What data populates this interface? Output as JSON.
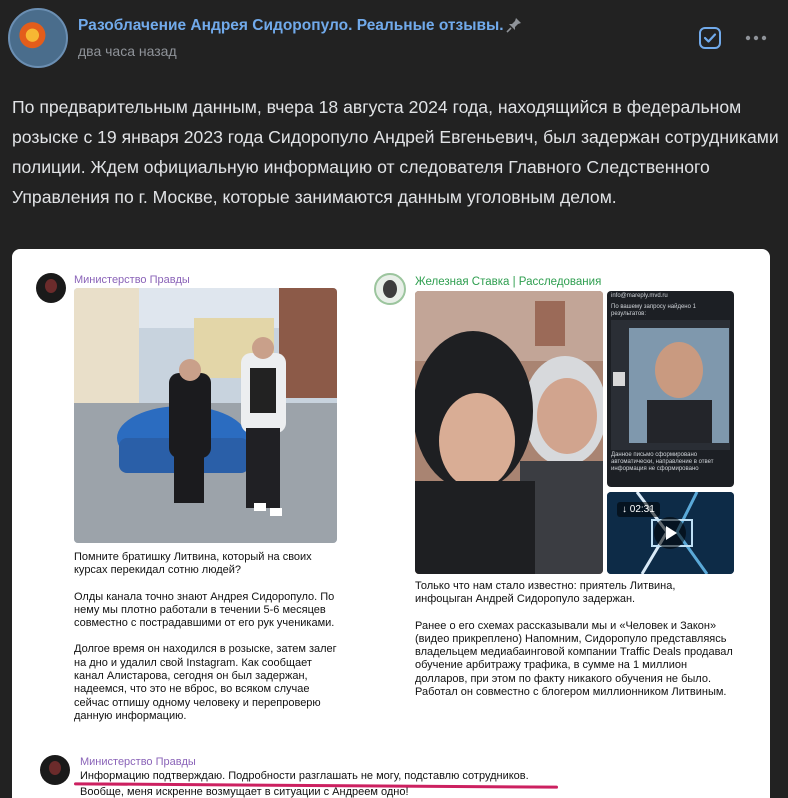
{
  "header": {
    "channel_title": "Разоблачение Андрея Сидоропуло. Реальные отзывы.",
    "time": "два часа назад",
    "icons": [
      "pin-icon",
      "checkbox-icon",
      "more-icon"
    ]
  },
  "post": {
    "text": "По предварительным данным, вчера 18 августа 2024 года, находящийся в федеральном розыске с 19 января 2023 года Сидоропуло Андрей Евгеньевич, был задержан сотрудниками полиции. Ждем официальную информацию от следователя Главного Следственного Управления по г. Москве, которые занимаются данным уголовным делом."
  },
  "screenshot": {
    "left": {
      "channel": "Министерство Правды",
      "p1": "Помните братишку Литвина, который на своих курсах перекидал сотню людей?",
      "p2": "Олды канала точно знают Андрея Сидоропуло. По нему мы плотно работали в течении 5-6 месяцев совместно с пострадавшими от его рук учениками.",
      "p3": "Долгое время он находился в розыске, затем залег на дно и удалил свой Instagram. Как сообщает канал Алистарова, сегодня он был задержан, надеемся, что это не вброс, во всяком случае сейчас отпишу одному человеку и перепроверю данную информацию."
    },
    "right": {
      "channel": "Железная Ставка | Расследования",
      "video_time": "02:31",
      "doc_line1": "info@mareply.mvd.ru",
      "doc_line2": "По вашему запросу найдено 1 результатов:",
      "doc_line3": "Данное письмо сформировано автоматически, направление в ответ информация не сформировано",
      "p1": "Только что нам стало известно: приятель Литвина, инфоцыган Андрей Сидоропуло задержан.",
      "p2": "Ранее о его схемах рассказывали мы и «Человек и Закон» (видео прикреплено) Напомним, Сидоропуло представляясь владельцем медиабаинговой компании Traffic Deals продавал обучение арбитражу трафика, в сумме на 1 миллион долларов, при этом по факту никакого обучения не было. Работал он совместно с блогером миллионником Литвиным."
    },
    "bottom": {
      "channel": "Министерство Правды",
      "line1": "Информацию подтверждаю. Подробности разглашать не могу, подставлю сотрудников.",
      "line2": "Вообще, меня искренне возмущает в ситуации с Андреем одно!"
    }
  },
  "colors": {
    "background": "#222222",
    "channel_title": "#71aaeb",
    "muted": "#8f9399",
    "left_channel": "#8a63b8",
    "right_channel": "#2e9e4f",
    "underline": "#cc2060"
  }
}
